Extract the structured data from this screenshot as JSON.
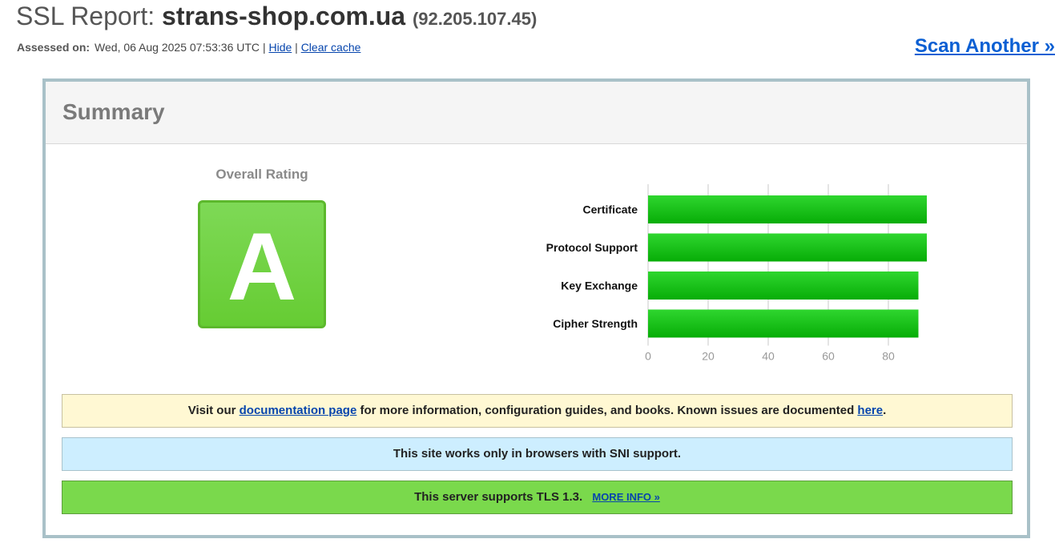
{
  "header": {
    "title_label": "SSL Report:",
    "host": "strans-shop.com.ua",
    "ip": "(92.205.107.45)",
    "assessed_label": "Assessed on:",
    "assessed_value": "Wed, 06 Aug 2025 07:53:36 UTC",
    "separator": "|",
    "hide_link": "Hide",
    "clear_cache_link": "Clear cache",
    "scan_another": "Scan Another »"
  },
  "summary": {
    "heading": "Summary",
    "overall_rating_label": "Overall Rating",
    "grade": "A"
  },
  "chart_data": {
    "type": "bar",
    "orientation": "horizontal",
    "categories": [
      "Certificate",
      "Protocol Support",
      "Key Exchange",
      "Cipher Strength"
    ],
    "values": [
      100,
      100,
      90,
      90
    ],
    "xlim": [
      0,
      100
    ],
    "ticks": [
      0,
      20,
      40,
      60,
      80,
      100
    ],
    "grid": true,
    "bar_color": "#11c011"
  },
  "notices": {
    "doc_prefix": "Visit our",
    "doc_link": "documentation page",
    "doc_middle": "for more information, configuration guides, and books. Known issues are documented",
    "doc_here": "here",
    "doc_suffix": ".",
    "sni_text": "This site works only in browsers with SNI support.",
    "tls_text": "This server supports TLS 1.3.",
    "tls_more": "MORE INFO »"
  },
  "colors": {
    "grade_green": "#66cc33",
    "link_blue": "#0645ad",
    "box_border": "#a9c1c8"
  }
}
